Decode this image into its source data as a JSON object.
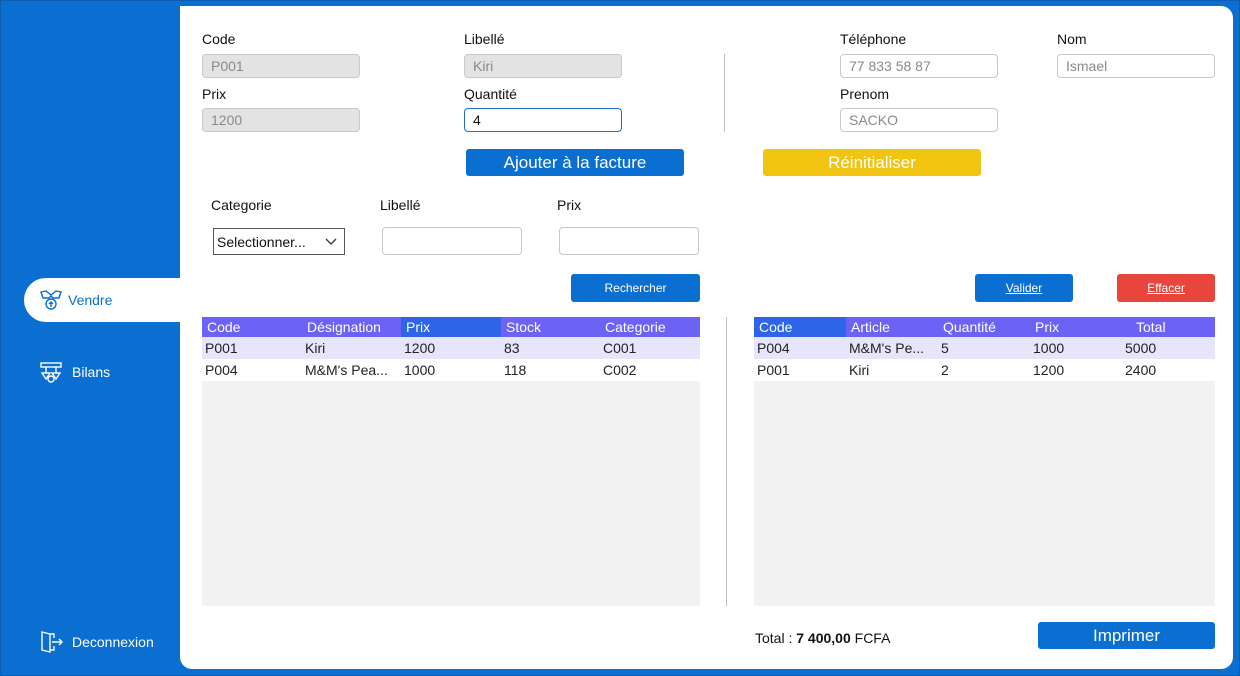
{
  "sidebar": {
    "items": [
      {
        "label": "Vendre",
        "icon": "sell-icon",
        "active": true
      },
      {
        "label": "Bilans",
        "icon": "balance-icon",
        "active": false
      }
    ],
    "logout_label": "Deconnexion"
  },
  "article_form": {
    "code_label": "Code",
    "code_value": "P001",
    "libelle_label": "Libellé",
    "libelle_value": "Kiri",
    "prix_label": "Prix",
    "prix_value": "1200",
    "quantite_label": "Quantité",
    "quantite_value": "4"
  },
  "client_form": {
    "telephone_label": "Téléphone",
    "telephone_value": "77 833 58 87",
    "nom_label": "Nom",
    "nom_value": "Ismael",
    "prenom_label": "Prenom",
    "prenom_value": "SACKO"
  },
  "actions": {
    "add_label": "Ajouter à la facture",
    "reset_label": "Réinitialiser",
    "search_label": "Rechercher",
    "validate_label": "Valider",
    "clear_label": "Effacer",
    "print_label": "Imprimer"
  },
  "filters": {
    "categorie_label": "Categorie",
    "categorie_selected": "Selectionner...",
    "libelle_label": "Libellé",
    "libelle_value": "",
    "prix_label": "Prix",
    "prix_value": ""
  },
  "products_table": {
    "columns": [
      "Code",
      "Désignation",
      "Prix",
      "Stock",
      "Categorie"
    ],
    "rows": [
      [
        "P001",
        "Kiri",
        "1200",
        "83",
        "C001"
      ],
      [
        "P004",
        "M&M's Pea...",
        "1000",
        "118",
        "C002"
      ]
    ]
  },
  "invoice_table": {
    "columns": [
      "Code",
      "Article",
      "Quantité",
      "Prix",
      "Total"
    ],
    "rows": [
      [
        "P004",
        "M&M's Pe...",
        "5",
        "1000",
        "5000"
      ],
      [
        "P001",
        "Kiri",
        "2",
        "1200",
        "2400"
      ]
    ]
  },
  "total": {
    "label": "Total :",
    "amount": "7 400,00",
    "currency": "FCFA"
  },
  "colors": {
    "primary": "#0a6fd1",
    "header": "#6c62f4",
    "warning": "#f2c412",
    "danger": "#e8453c"
  }
}
